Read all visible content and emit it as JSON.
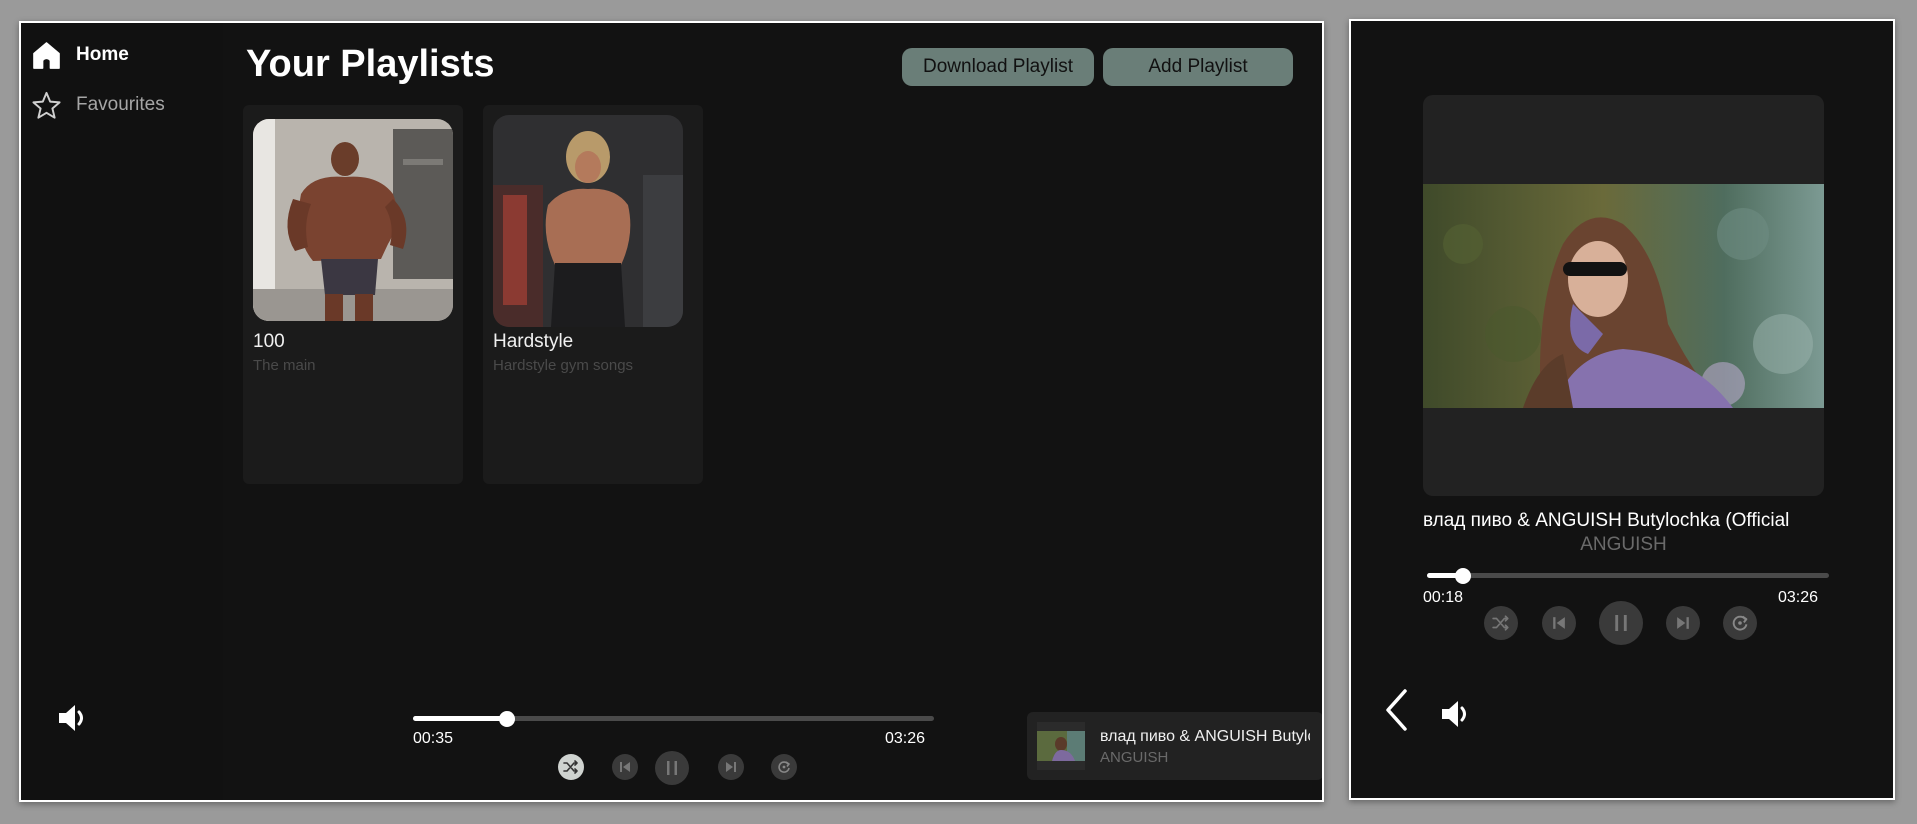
{
  "sidebar": {
    "items": [
      {
        "label": "Home",
        "icon": "home-icon",
        "active": true
      },
      {
        "label": "Favourites",
        "icon": "star-icon",
        "active": false
      }
    ],
    "volume_icon": "volume-icon"
  },
  "header": {
    "title": "Your Playlists",
    "download_label": "Download Playlist",
    "add_label": "Add Playlist"
  },
  "playlists": [
    {
      "title": "100",
      "subtitle": "The main"
    },
    {
      "title": "Hardstyle",
      "subtitle": "Hardstyle gym songs"
    }
  ],
  "player": {
    "elapsed": "00:35",
    "total": "03:26",
    "progress": 0.18,
    "controls": [
      "shuffle-icon",
      "previous-icon",
      "pause-icon",
      "next-icon",
      "repeat-icon"
    ]
  },
  "mini_player": {
    "title": "влад пиво & ANGUISH  Butylochka (Official",
    "artist": "ANGUISH"
  },
  "now_playing": {
    "title": "влад пиво & ANGUISH  Butylochka (Official",
    "artist": "ANGUISH",
    "elapsed": "00:18",
    "total": "03:26",
    "progress": 0.09
  },
  "colors": {
    "background": "#121212",
    "card": "#1b1b1b",
    "accent_button": "#6a7e78",
    "control": "#3a3a3a",
    "track": "#4a4a4a"
  }
}
